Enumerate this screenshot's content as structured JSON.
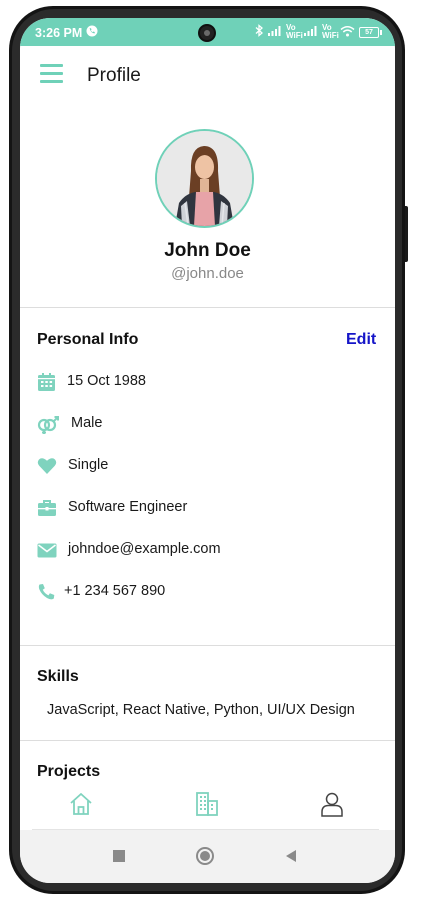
{
  "status_bar": {
    "time": "3:26 PM",
    "call_icon": "phone-call-icon",
    "vo_wifi_1": "Vo WiFi",
    "vo_wifi_2": "Vo WiFi",
    "battery": "57"
  },
  "header": {
    "title": "Profile",
    "menu_icon": "hamburger-menu-icon"
  },
  "profile": {
    "name": "John Doe",
    "handle": "@john.doe"
  },
  "personal_info": {
    "title": "Personal Info",
    "edit_label": "Edit",
    "items": [
      {
        "icon": "calendar-icon",
        "text": "15 Oct 1988"
      },
      {
        "icon": "gender-icon",
        "text": "Male"
      },
      {
        "icon": "heart-icon",
        "text": "Single"
      },
      {
        "icon": "briefcase-icon",
        "text": "Software Engineer"
      },
      {
        "icon": "envelope-icon",
        "text": "johndoe@example.com"
      },
      {
        "icon": "phone-icon",
        "text": "+1 234 567 890"
      }
    ]
  },
  "skills": {
    "title": "Skills",
    "text": "JavaScript, React Native, Python, UI/UX Design"
  },
  "projects": {
    "title": "Projects"
  },
  "bottom_nav": {
    "items": [
      {
        "icon": "home-icon"
      },
      {
        "icon": "building-icon"
      },
      {
        "icon": "user-icon"
      }
    ]
  },
  "system_nav": {
    "items": [
      {
        "icon": "recents-square-icon"
      },
      {
        "icon": "home-circle-icon"
      },
      {
        "icon": "back-triangle-icon"
      }
    ]
  },
  "colors": {
    "accent": "#6fd1b8",
    "edit_link": "#1515c8"
  }
}
